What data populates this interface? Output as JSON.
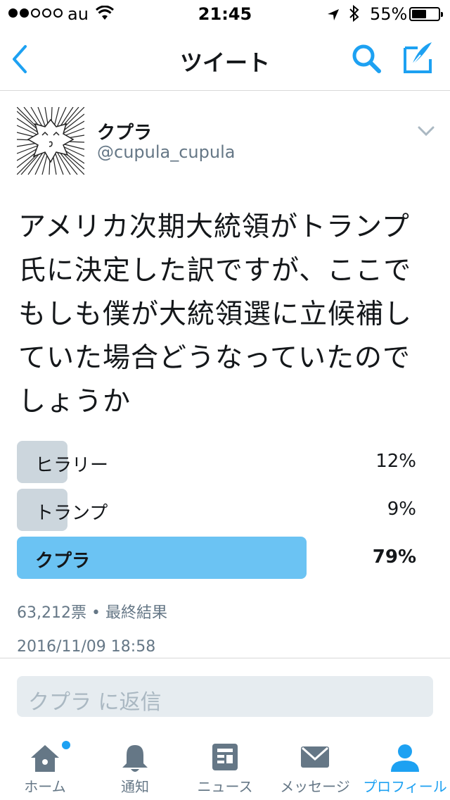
{
  "status_bar": {
    "carrier": "au",
    "time": "21:45",
    "battery_percent": "55%",
    "battery_level": 0.55,
    "signal_bars_filled": 2,
    "signal_bars_total": 5
  },
  "nav": {
    "title": "ツイート",
    "back_icon": "chevron-left-icon",
    "search_icon": "search-icon",
    "compose_icon": "compose-icon"
  },
  "tweet": {
    "author_name": "クプラ",
    "author_handle": "@cupula_cupula",
    "text_lines": [
      "アメリカ次期大統領がトランプ",
      "氏に決定した訳ですが、ここで",
      "もしも僕が大統領選に立候補し",
      "ていた場合どうなっていたので",
      "しょうか"
    ],
    "timestamp": "2016/11/09 18:58"
  },
  "poll": {
    "options": [
      {
        "label": "ヒラリー",
        "percent_text": "12%",
        "percent": 12,
        "winner": false
      },
      {
        "label": "トランプ",
        "percent_text": "9%",
        "percent": 9,
        "winner": false
      },
      {
        "label": "クプラ",
        "percent_text": "79%",
        "percent": 79,
        "winner": true
      }
    ],
    "votes": "63,212票",
    "separator": "•",
    "status": "最終結果"
  },
  "reply": {
    "placeholder": "クプラ に返信"
  },
  "tabs": [
    {
      "label": "ホーム",
      "icon": "home-icon",
      "active": false
    },
    {
      "label": "通知",
      "icon": "bell-icon",
      "active": false
    },
    {
      "label": "ニュース",
      "icon": "news-icon",
      "active": false
    },
    {
      "label": "メッセージ",
      "icon": "envelope-icon",
      "active": false
    },
    {
      "label": "プロフィール",
      "icon": "person-icon",
      "active": true
    }
  ],
  "colors": {
    "accent": "#1da1f2",
    "poll_bar": "#ccd6dd",
    "poll_winner": "#6bc3f3",
    "secondary_text": "#657786"
  }
}
